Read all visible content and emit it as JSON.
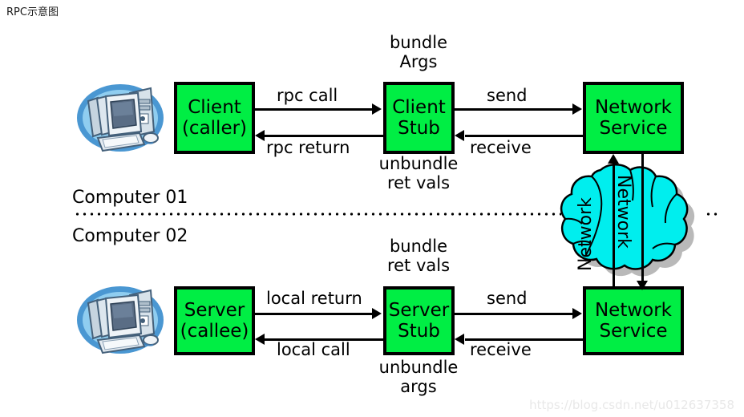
{
  "page": {
    "title": "RPC示意图",
    "watermark": "https://blog.csdn.net/u012637358"
  },
  "colors": {
    "box_fill": "#00ee44",
    "box_stroke": "#000000",
    "cloud_fill": "#00eeee",
    "cloud_shadow": "#808080",
    "icon_disc_outer": "#4a97d2",
    "icon_disc_inner": "#8fcdf0",
    "watermark": "#e8e8e8"
  },
  "boxes": {
    "client": {
      "line1": "Client",
      "line2": "(caller)"
    },
    "client_stub": {
      "line1": "Client",
      "line2": "Stub"
    },
    "network_1": {
      "line1": "Network",
      "line2": "Service"
    },
    "server": {
      "line1": "Server",
      "line2": "(callee)"
    },
    "server_stub": {
      "line1": "Server",
      "line2": "Stub"
    },
    "network_2": {
      "line1": "Network",
      "line2": "Service"
    }
  },
  "labels": {
    "rpc_call": "rpc call",
    "rpc_return": "rpc return",
    "bundle_args_l1": "bundle",
    "bundle_args_l2": "Args",
    "unbundle_retvals_l1": "unbundle",
    "unbundle_retvals_l2": "ret vals",
    "send_top": "send",
    "receive_top": "receive",
    "local_return": "local return",
    "local_call": "local call",
    "bundle_retvals_l1": "bundle",
    "bundle_retvals_l2": "ret vals",
    "unbundle_args_l1": "unbundle",
    "unbundle_args_l2": "args",
    "send_bottom": "send",
    "receive_bottom": "receive",
    "computer_01": "Computer 01",
    "computer_02": "Computer 02",
    "network_up": "Network",
    "network_down": "Network"
  },
  "icons": {
    "computer_top": "desktop-computer-icon",
    "computer_bottom": "desktop-computer-icon",
    "cloud": "network-cloud-icon"
  }
}
